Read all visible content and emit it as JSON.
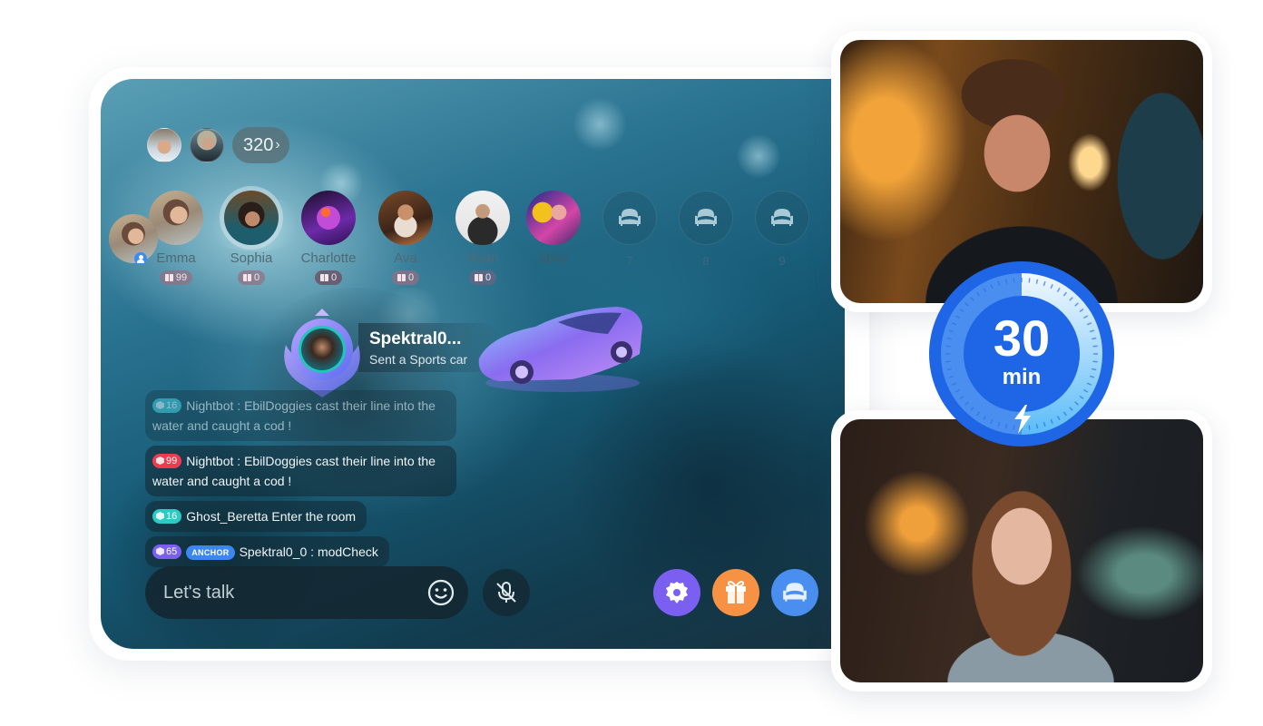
{
  "room": {
    "viewers": {
      "avatars": [
        "viewer-1",
        "viewer-2"
      ],
      "count": "320",
      "more_icon": "chevron-right-icon"
    },
    "seats": [
      {
        "name": "Emma",
        "gifts": "99",
        "role": "host",
        "occupied": true
      },
      {
        "name": "Sophia",
        "gifts": "0",
        "occupied": true,
        "speaking": true
      },
      {
        "name": "Charlotte",
        "gifts": "0",
        "occupied": true
      },
      {
        "name": "Ava",
        "gifts": "0",
        "occupied": true
      },
      {
        "name": "Ryan",
        "gifts": "0",
        "occupied": true
      },
      {
        "name": "abey",
        "occupied": true
      },
      {
        "number": "7",
        "occupied": false,
        "icon": "sofa-icon"
      },
      {
        "number": "8",
        "occupied": false,
        "icon": "sofa-icon"
      },
      {
        "number": "9",
        "occupied": false,
        "icon": "sofa-icon"
      }
    ],
    "gift_notice": {
      "sender": "Spektral0...",
      "message": "Sent a Sports car",
      "gift": "sports-car"
    },
    "chat": [
      {
        "level": "16",
        "level_color": "#3fc7d6",
        "text": "Nightbot : EbilDoggies cast their line into the water and caught a cod !",
        "faded": true
      },
      {
        "level": "99",
        "level_color": "#ee3b4f",
        "text": "Nightbot : EbilDoggies cast their line into the water and caught a cod !"
      },
      {
        "level": "16",
        "level_color": "#2fc9c4",
        "text": "Ghost_Beretta Enter the room"
      },
      {
        "level": "65",
        "level_color": "#7b5ff0",
        "badge": "ANCHOR",
        "text": "Spektral0_0 : modCheck"
      }
    ],
    "input": {
      "placeholder": "Let's talk",
      "value": ""
    },
    "actions": {
      "emoji": "emoji-icon",
      "mic": "mic-off-icon",
      "settings": "gear-icon",
      "gift": "gift-icon",
      "seat": "sofa-icon"
    },
    "colors": {
      "settings": "#7b5ff0",
      "gift": "#f79245",
      "seat": "#4a8ff0",
      "anchor": "#3b86f0",
      "host": "#3d8bf2"
    }
  },
  "timer": {
    "value": "30",
    "unit": "min",
    "progress": 0.5,
    "color": "#1e66e6",
    "icon": "lightning-icon"
  },
  "photos": [
    {
      "subject": "male-streamer-with-headset"
    },
    {
      "subject": "female-streamer-with-headset"
    }
  ]
}
